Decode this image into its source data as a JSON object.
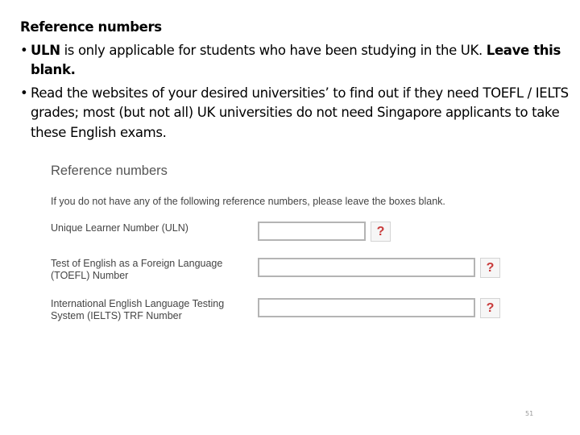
{
  "slide": {
    "title": "Reference numbers",
    "bullets": [
      {
        "bold_prefix": "ULN",
        "text": " is only applicable for students who have been studying in the UK. ",
        "bold_suffix": "Leave this blank."
      },
      {
        "text": "Read the websites of your desired universities’ to find out if they need TOEFL / IELTS grades; most (but not all) UK universities do not need Singapore applicants to take these English exams."
      }
    ],
    "bullet_glyph": "•",
    "page_number": "51"
  },
  "form": {
    "heading": "Reference numbers",
    "intro": "If you do not have any of the following reference numbers, please leave the boxes blank.",
    "fields": [
      {
        "label": "Unique Learner Number (ULN)",
        "value": "",
        "help_label": "?",
        "help_icon": "question-mark-icon"
      },
      {
        "label": "Test of English as a Foreign Language (TOEFL) Number",
        "value": "",
        "help_label": "?",
        "help_icon": "question-mark-icon"
      },
      {
        "label": "International English Language Testing System (IELTS) TRF Number",
        "value": "",
        "help_label": "?",
        "help_icon": "question-mark-icon"
      }
    ],
    "colors": {
      "help_glyph": "#c83a3a",
      "input_border": "#b4b4b4",
      "label_text": "#444444"
    }
  }
}
